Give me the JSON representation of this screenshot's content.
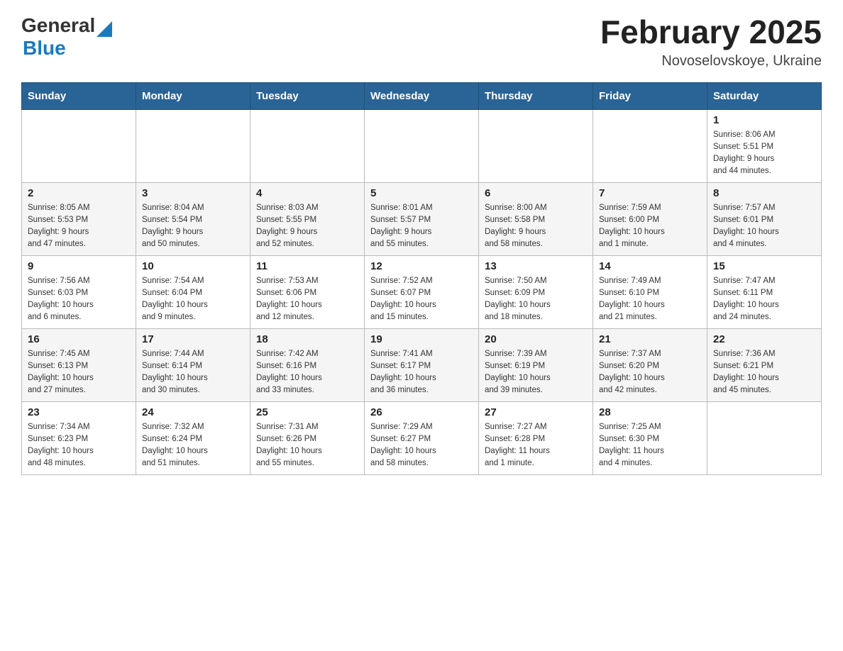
{
  "header": {
    "logo_general": "General",
    "logo_blue": "Blue",
    "month_year": "February 2025",
    "location": "Novoselovskoye, Ukraine"
  },
  "days_of_week": [
    "Sunday",
    "Monday",
    "Tuesday",
    "Wednesday",
    "Thursday",
    "Friday",
    "Saturday"
  ],
  "weeks": [
    [
      {
        "day": "",
        "info": ""
      },
      {
        "day": "",
        "info": ""
      },
      {
        "day": "",
        "info": ""
      },
      {
        "day": "",
        "info": ""
      },
      {
        "day": "",
        "info": ""
      },
      {
        "day": "",
        "info": ""
      },
      {
        "day": "1",
        "info": "Sunrise: 8:06 AM\nSunset: 5:51 PM\nDaylight: 9 hours\nand 44 minutes."
      }
    ],
    [
      {
        "day": "2",
        "info": "Sunrise: 8:05 AM\nSunset: 5:53 PM\nDaylight: 9 hours\nand 47 minutes."
      },
      {
        "day": "3",
        "info": "Sunrise: 8:04 AM\nSunset: 5:54 PM\nDaylight: 9 hours\nand 50 minutes."
      },
      {
        "day": "4",
        "info": "Sunrise: 8:03 AM\nSunset: 5:55 PM\nDaylight: 9 hours\nand 52 minutes."
      },
      {
        "day": "5",
        "info": "Sunrise: 8:01 AM\nSunset: 5:57 PM\nDaylight: 9 hours\nand 55 minutes."
      },
      {
        "day": "6",
        "info": "Sunrise: 8:00 AM\nSunset: 5:58 PM\nDaylight: 9 hours\nand 58 minutes."
      },
      {
        "day": "7",
        "info": "Sunrise: 7:59 AM\nSunset: 6:00 PM\nDaylight: 10 hours\nand 1 minute."
      },
      {
        "day": "8",
        "info": "Sunrise: 7:57 AM\nSunset: 6:01 PM\nDaylight: 10 hours\nand 4 minutes."
      }
    ],
    [
      {
        "day": "9",
        "info": "Sunrise: 7:56 AM\nSunset: 6:03 PM\nDaylight: 10 hours\nand 6 minutes."
      },
      {
        "day": "10",
        "info": "Sunrise: 7:54 AM\nSunset: 6:04 PM\nDaylight: 10 hours\nand 9 minutes."
      },
      {
        "day": "11",
        "info": "Sunrise: 7:53 AM\nSunset: 6:06 PM\nDaylight: 10 hours\nand 12 minutes."
      },
      {
        "day": "12",
        "info": "Sunrise: 7:52 AM\nSunset: 6:07 PM\nDaylight: 10 hours\nand 15 minutes."
      },
      {
        "day": "13",
        "info": "Sunrise: 7:50 AM\nSunset: 6:09 PM\nDaylight: 10 hours\nand 18 minutes."
      },
      {
        "day": "14",
        "info": "Sunrise: 7:49 AM\nSunset: 6:10 PM\nDaylight: 10 hours\nand 21 minutes."
      },
      {
        "day": "15",
        "info": "Sunrise: 7:47 AM\nSunset: 6:11 PM\nDaylight: 10 hours\nand 24 minutes."
      }
    ],
    [
      {
        "day": "16",
        "info": "Sunrise: 7:45 AM\nSunset: 6:13 PM\nDaylight: 10 hours\nand 27 minutes."
      },
      {
        "day": "17",
        "info": "Sunrise: 7:44 AM\nSunset: 6:14 PM\nDaylight: 10 hours\nand 30 minutes."
      },
      {
        "day": "18",
        "info": "Sunrise: 7:42 AM\nSunset: 6:16 PM\nDaylight: 10 hours\nand 33 minutes."
      },
      {
        "day": "19",
        "info": "Sunrise: 7:41 AM\nSunset: 6:17 PM\nDaylight: 10 hours\nand 36 minutes."
      },
      {
        "day": "20",
        "info": "Sunrise: 7:39 AM\nSunset: 6:19 PM\nDaylight: 10 hours\nand 39 minutes."
      },
      {
        "day": "21",
        "info": "Sunrise: 7:37 AM\nSunset: 6:20 PM\nDaylight: 10 hours\nand 42 minutes."
      },
      {
        "day": "22",
        "info": "Sunrise: 7:36 AM\nSunset: 6:21 PM\nDaylight: 10 hours\nand 45 minutes."
      }
    ],
    [
      {
        "day": "23",
        "info": "Sunrise: 7:34 AM\nSunset: 6:23 PM\nDaylight: 10 hours\nand 48 minutes."
      },
      {
        "day": "24",
        "info": "Sunrise: 7:32 AM\nSunset: 6:24 PM\nDaylight: 10 hours\nand 51 minutes."
      },
      {
        "day": "25",
        "info": "Sunrise: 7:31 AM\nSunset: 6:26 PM\nDaylight: 10 hours\nand 55 minutes."
      },
      {
        "day": "26",
        "info": "Sunrise: 7:29 AM\nSunset: 6:27 PM\nDaylight: 10 hours\nand 58 minutes."
      },
      {
        "day": "27",
        "info": "Sunrise: 7:27 AM\nSunset: 6:28 PM\nDaylight: 11 hours\nand 1 minute."
      },
      {
        "day": "28",
        "info": "Sunrise: 7:25 AM\nSunset: 6:30 PM\nDaylight: 11 hours\nand 4 minutes."
      },
      {
        "day": "",
        "info": ""
      }
    ]
  ]
}
